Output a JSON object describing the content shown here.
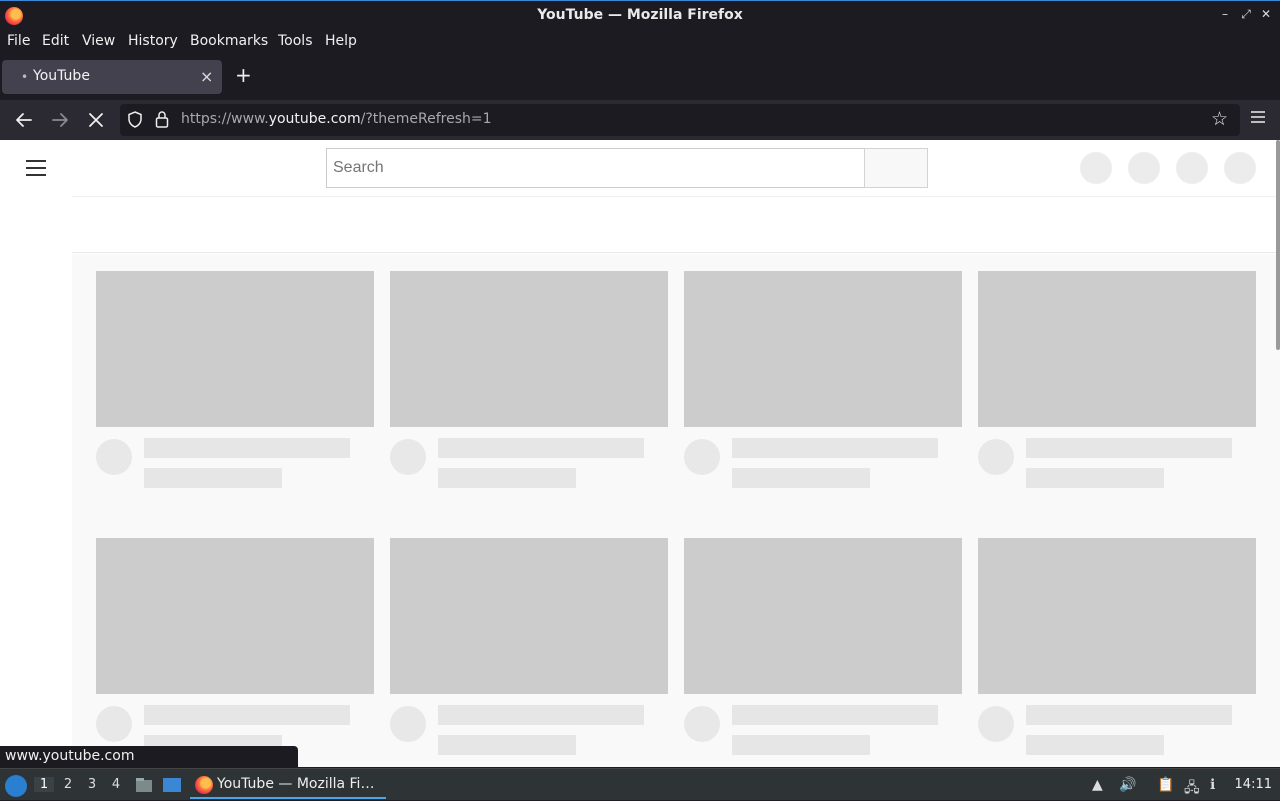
{
  "window": {
    "title": "YouTube — Mozilla Firefox",
    "controls": [
      "–",
      "⤢",
      "✕"
    ]
  },
  "menu": {
    "items": [
      "File",
      "Edit",
      "View",
      "History",
      "Bookmarks",
      "Tools",
      "Help"
    ]
  },
  "tabs": [
    {
      "label": "YouTube",
      "loading_dot": "•",
      "close": "×"
    }
  ],
  "newtab": "+",
  "nav": {
    "url_prefix": "https://www.",
    "url_host": "youtube.com",
    "url_suffix": "/?themeRefresh=1"
  },
  "page": {
    "search_placeholder": "Search"
  },
  "status_text": "www.youtube.com",
  "taskbar": {
    "workspaces": [
      "1",
      "2",
      "3",
      "4"
    ],
    "app_label": "YouTube — Mozilla Fi…",
    "clock": "14:11"
  },
  "colors": {
    "accent": "#3a88d8",
    "skeleton_thumb": "#cccccc",
    "skeleton_line": "#e6e6e6"
  }
}
